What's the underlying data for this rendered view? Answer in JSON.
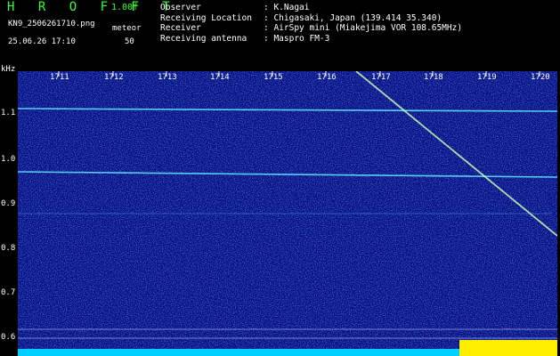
{
  "header": {
    "app_title": "H R O F F T",
    "version": "1.00f",
    "filename": "KN9_2506261710.png",
    "mode": "meteor",
    "timestamp": "25.06.26 17:10",
    "count": "50"
  },
  "meta": [
    {
      "key": "Observer",
      "value": ": K.Nagai"
    },
    {
      "key": "Receiving Location",
      "value": ": Chigasaki, Japan (139.414 35.340)"
    },
    {
      "key": "Receiver",
      "value": ": AirSpy mini (Miakejima VOR 108.65MHz)"
    },
    {
      "key": "Receiving antenna",
      "value": ": Maspro FM-3"
    }
  ],
  "axis": {
    "y_unit": "kHz",
    "y_ticks": [
      "1.1",
      "1.0",
      "0.9",
      "0.8",
      "0.7",
      "0.6"
    ],
    "x_ticks": [
      "1711",
      "1712",
      "1713",
      "1714",
      "1715",
      "1716",
      "1717",
      "1718",
      "1719",
      "1720"
    ]
  },
  "colors": {
    "background": "#0a0a7a",
    "trace": "#5fe0ff",
    "title_green": "#33ff33"
  }
}
